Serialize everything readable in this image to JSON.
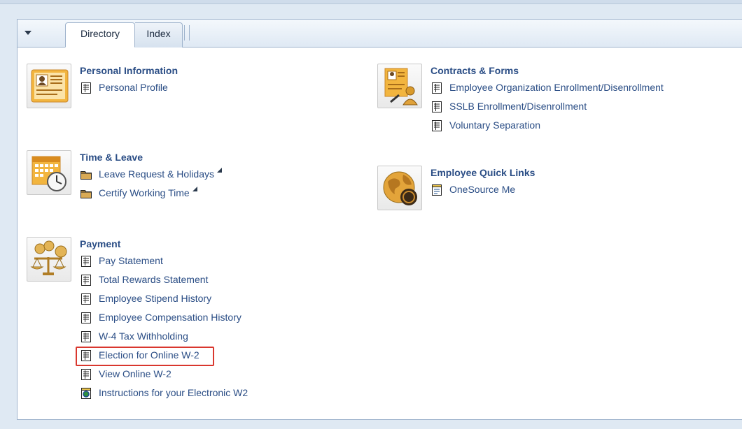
{
  "tabs": [
    {
      "label": "Directory",
      "active": true
    },
    {
      "label": "Index",
      "active": false
    }
  ],
  "sections": {
    "personal": {
      "title": "Personal Information",
      "icon": "id-card-icon",
      "links": [
        {
          "label": "Personal Profile",
          "icon": "page-icon"
        }
      ]
    },
    "contracts": {
      "title": "Contracts & Forms",
      "icon": "contract-icon",
      "links": [
        {
          "label": "Employee Organization Enrollment/Disenrollment",
          "icon": "page-icon"
        },
        {
          "label": "SSLB Enrollment/Disenrollment",
          "icon": "page-icon"
        },
        {
          "label": "Voluntary Separation",
          "icon": "page-icon"
        }
      ]
    },
    "time": {
      "title": "Time & Leave",
      "icon": "calendar-clock-icon",
      "links": [
        {
          "label": "Leave Request & Holidays",
          "icon": "folder-icon"
        },
        {
          "label": "Certify Working Time",
          "icon": "folder-icon"
        }
      ]
    },
    "quicklinks": {
      "title": "Employee Quick Links",
      "icon": "globe-icon",
      "links": [
        {
          "label": "OneSource Me",
          "icon": "web-page-icon"
        }
      ]
    },
    "payment": {
      "title": "Payment",
      "icon": "coins-scale-icon",
      "links": [
        {
          "label": "Pay Statement",
          "icon": "page-icon"
        },
        {
          "label": "Total Rewards Statement",
          "icon": "page-icon"
        },
        {
          "label": "Employee Stipend History",
          "icon": "page-icon"
        },
        {
          "label": "Employee Compensation History",
          "icon": "page-icon"
        },
        {
          "label": "W-4 Tax Withholding",
          "icon": "page-icon"
        },
        {
          "label": "Election for Online W-2",
          "icon": "page-icon",
          "highlighted": true
        },
        {
          "label": "View Online W-2",
          "icon": "page-icon"
        },
        {
          "label": "Instructions for your Electronic W2",
          "icon": "web-page-icon"
        }
      ]
    }
  },
  "colors": {
    "link": "#2a4d85",
    "highlight_border": "#d9372e",
    "panel_border": "#9eb3cc"
  }
}
